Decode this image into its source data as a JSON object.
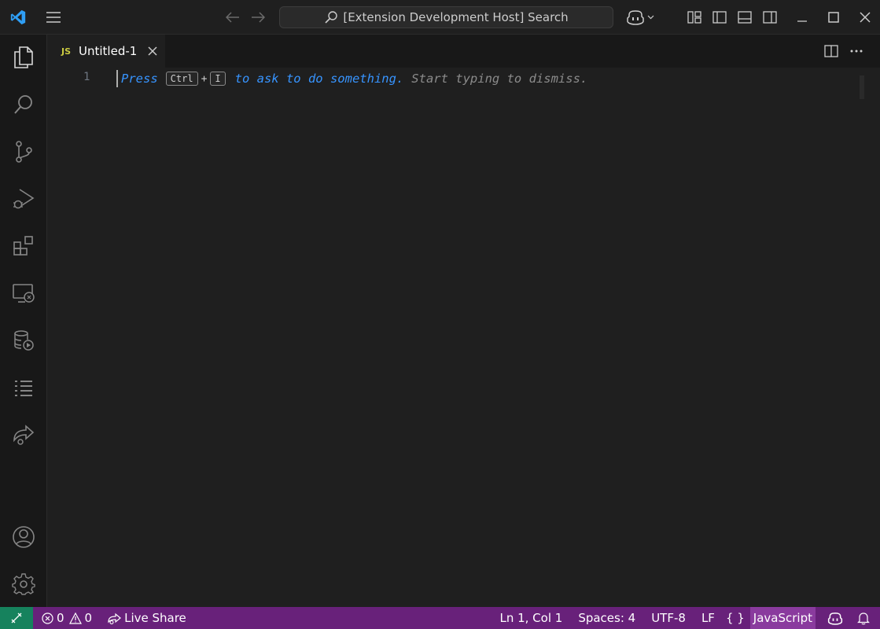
{
  "titlebar": {
    "search_text": "[Extension Development Host] Search"
  },
  "activity_bar": {
    "items": [
      "explorer",
      "search",
      "source-control",
      "run-and-debug",
      "extensions",
      "remote-explorer",
      "database",
      "testing-list",
      "live-share"
    ],
    "bottom": [
      "accounts",
      "manage"
    ]
  },
  "tab": {
    "language_badge": "JS",
    "label": "Untitled-1"
  },
  "editor": {
    "line_number": "1",
    "hint_press": "Press",
    "hint_key1": "Ctrl",
    "hint_plus": "+",
    "hint_key2": "I",
    "hint_ask": "to ask to do something.",
    "hint_dismiss": "Start typing to dismiss."
  },
  "statusbar": {
    "errors": "0",
    "warnings": "0",
    "live_share": "Live Share",
    "position": "Ln 1, Col 1",
    "spaces": "Spaces: 4",
    "encoding": "UTF-8",
    "eol": "LF",
    "braces": "{ }",
    "language": "JavaScript"
  },
  "colors": {
    "statusbar": "#68217a",
    "remote": "#16825d",
    "accent": "#3794ff"
  }
}
